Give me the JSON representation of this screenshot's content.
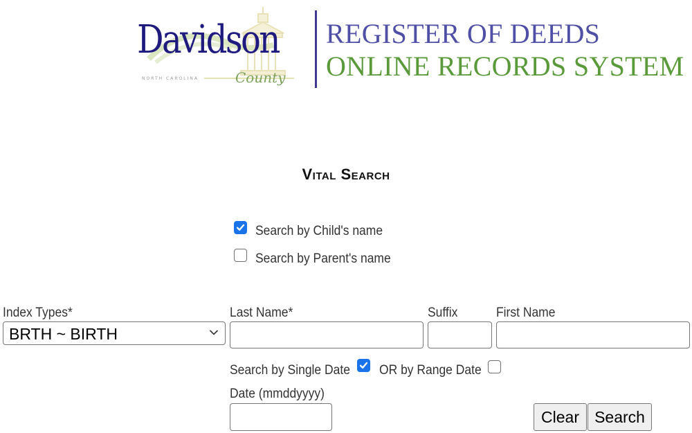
{
  "header": {
    "logo": {
      "wordmark": "Davidson",
      "state": "NORTH CAROLINA",
      "county": "County"
    },
    "title_line1": "REGISTER OF DEEDS",
    "title_line2": "ONLINE RECORDS SYSTEM",
    "colors": {
      "line1": "#4f4fa6",
      "line2": "#5a9a3a",
      "divider": "#3f3791",
      "wordmark": "#1f1a7e"
    }
  },
  "page": {
    "title": "Vital Search"
  },
  "search_mode": {
    "options": [
      {
        "label": "Search by Child's name",
        "checked": true
      },
      {
        "label": "Search by Parent's name",
        "checked": false
      }
    ]
  },
  "form": {
    "index_types": {
      "label": "Index Types*",
      "selected": "BRTH ~ BIRTH"
    },
    "last_name": {
      "label": "Last Name*",
      "value": ""
    },
    "suffix": {
      "label": "Suffix",
      "value": ""
    },
    "first_name": {
      "label": "First Name",
      "value": ""
    },
    "single_date": {
      "label": "Search by Single Date",
      "checked": true
    },
    "range_date": {
      "label": "OR by Range Date",
      "checked": false
    },
    "date": {
      "label": "Date (mmddyyyy)",
      "value": ""
    }
  },
  "buttons": {
    "clear": "Clear",
    "search": "Search"
  },
  "colors": {
    "checkbox_accent": "#1a73e8"
  }
}
